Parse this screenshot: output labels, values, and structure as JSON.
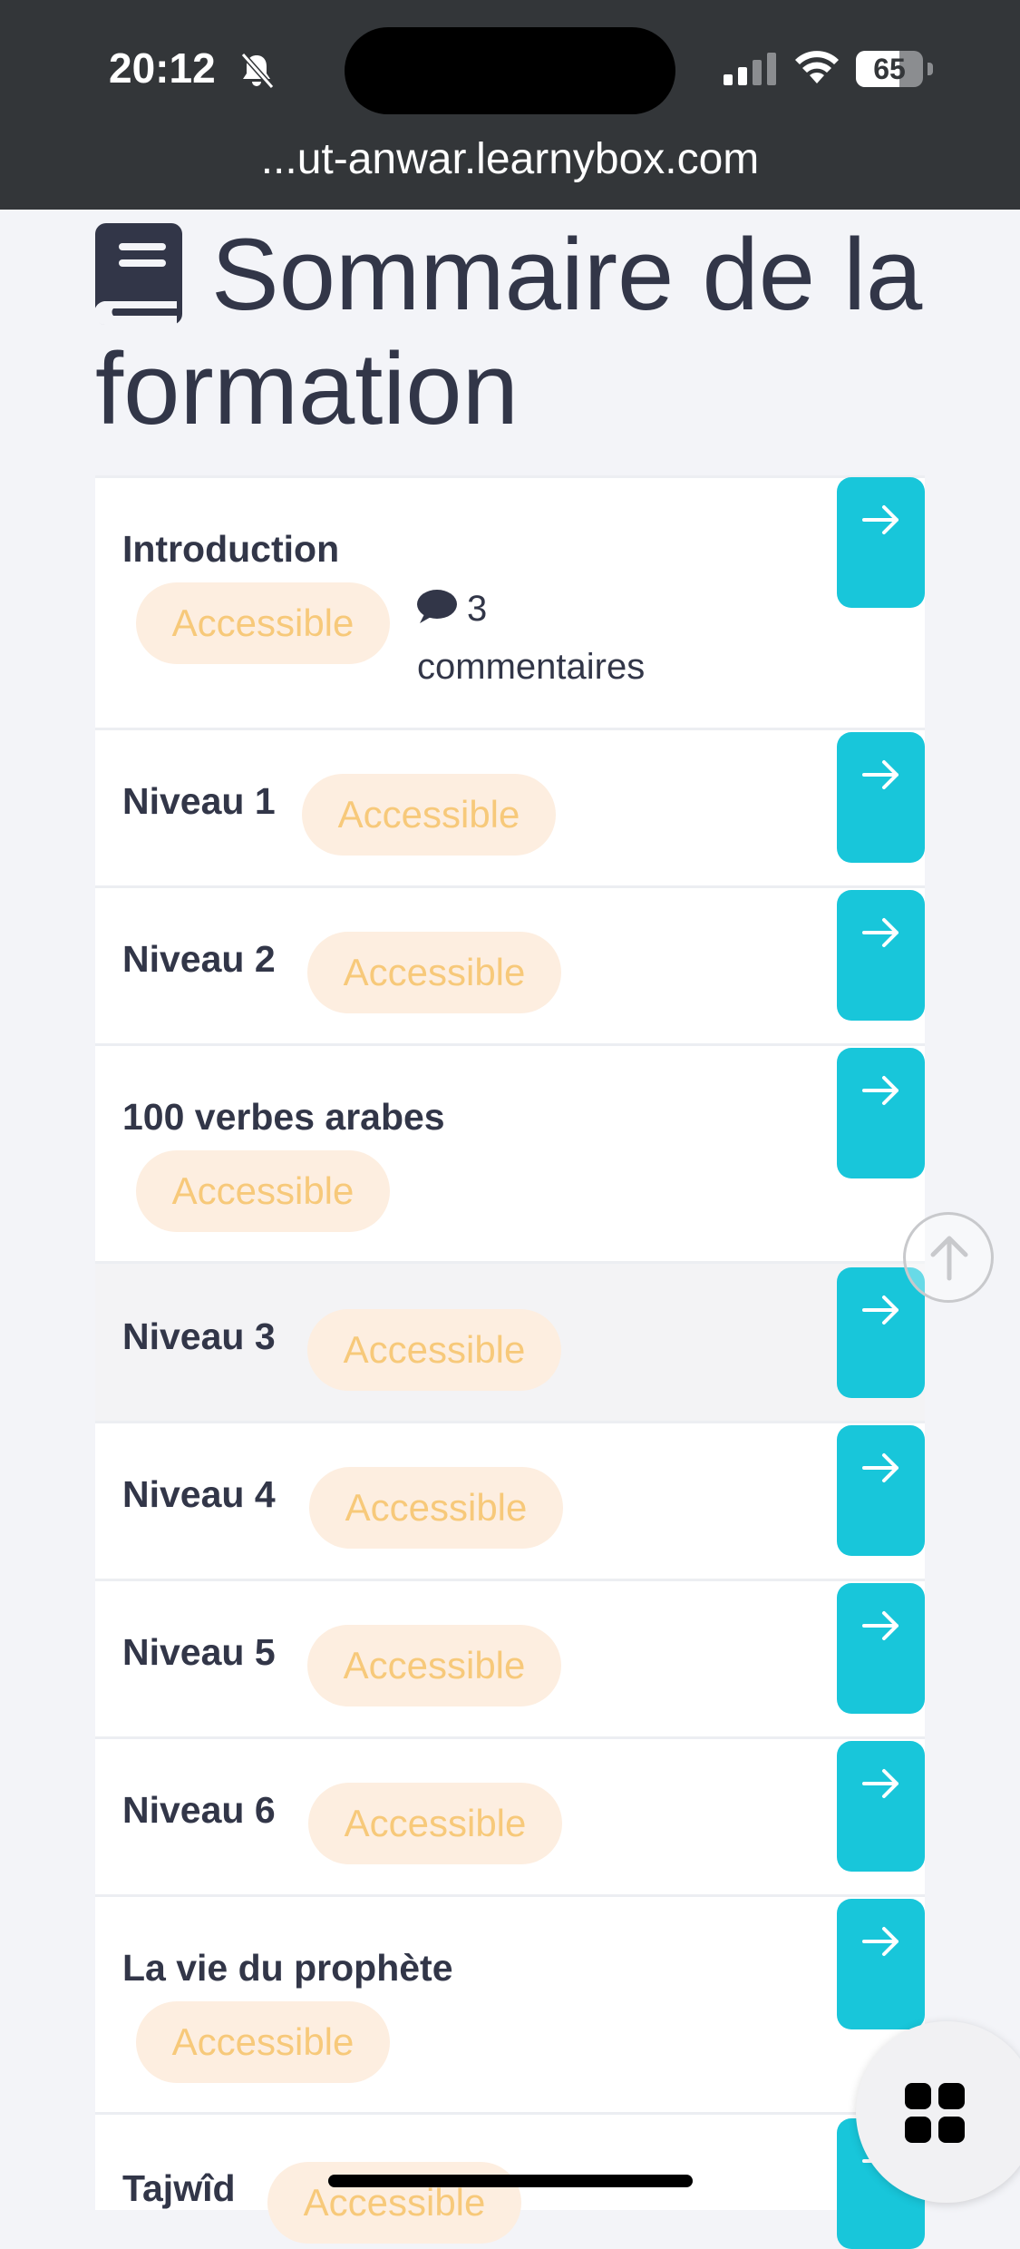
{
  "status_bar": {
    "time": "20:12",
    "battery": "65",
    "battery_level": 0.65,
    "url": "...ut-anwar.learnybox.com",
    "icons": [
      "bell-slash-icon",
      "signal-icon",
      "wifi-icon",
      "battery-icon"
    ]
  },
  "page": {
    "title": "Sommaire de la formation",
    "title_icon": "book-icon"
  },
  "lessons": [
    {
      "title": "Introduction",
      "status": "Accessible",
      "comments_count": "3",
      "comments_label": "commentaires"
    },
    {
      "title": "Niveau 1",
      "status": "Accessible"
    },
    {
      "title": "Niveau 2",
      "status": "Accessible"
    },
    {
      "title": "100 verbes arabes",
      "status": "Accessible"
    },
    {
      "title": "Niveau 3",
      "status": "Accessible"
    },
    {
      "title": "Niveau 4",
      "status": "Accessible"
    },
    {
      "title": "Niveau 5",
      "status": "Accessible"
    },
    {
      "title": "Niveau 6",
      "status": "Accessible"
    },
    {
      "title": "La vie du prophète",
      "status": "Accessible"
    },
    {
      "title": "Tajwîd",
      "status": "Accessible"
    }
  ],
  "colors": {
    "accent": "#18c6da",
    "badge_bg": "#fdeee0",
    "badge_text": "#f7c97a",
    "title_text": "#323648"
  },
  "controls": {
    "open_lesson_icon": "arrow-right-icon",
    "scroll_top_icon": "arrow-up-icon",
    "menu_icon": "grid-icon"
  }
}
